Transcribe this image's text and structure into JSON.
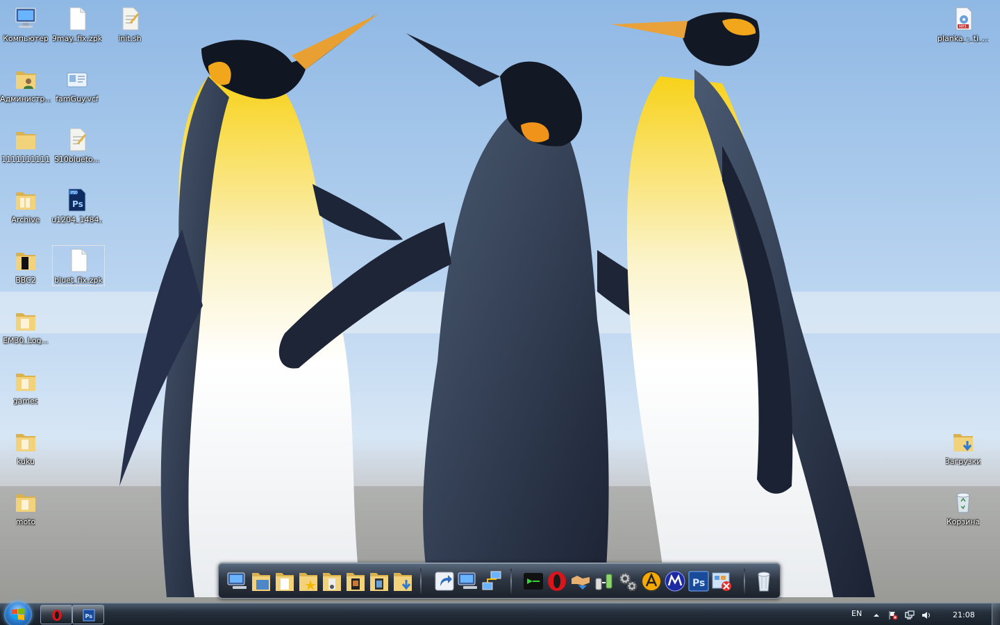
{
  "desktop": {
    "icons": [
      {
        "label": "Компьютер",
        "icon": "computer-icon"
      },
      {
        "label": "9may_fix.zpk",
        "icon": "file-icon"
      },
      {
        "label": "init.sh",
        "icon": "script-file-icon"
      },
      {
        "label": "Администр...",
        "icon": "user-folder-icon"
      },
      {
        "label": "famGuy.vcf",
        "icon": "contact-card-icon"
      },
      {
        "label": "1111111111",
        "icon": "folder-icon"
      },
      {
        "label": "S10blueto...",
        "icon": "script-file-icon"
      },
      {
        "label": "Archive",
        "icon": "folder-icon"
      },
      {
        "label": "u1204_1484...",
        "icon": "photoshop-file-icon"
      },
      {
        "label": "BBC2",
        "icon": "folder-icon"
      },
      {
        "label": "bluet_fix.zpk",
        "icon": "file-icon"
      },
      {
        "label": "EM30_Log...",
        "icon": "folder-icon"
      },
      {
        "label": "games",
        "icon": "folder-icon"
      },
      {
        "label": "kuku",
        "icon": "folder-icon"
      },
      {
        "label": "moto",
        "icon": "folder-icon"
      },
      {
        "label": "planka_-_ti_...",
        "icon": "mp3-file-icon"
      },
      {
        "label": "Загрузки",
        "icon": "downloads-folder-icon"
      },
      {
        "label": "Корзина",
        "icon": "recycle-bin-icon"
      }
    ]
  },
  "dock": {
    "items": [
      "computer-icon",
      "documents-folder-icon",
      "document-folder-icon",
      "favorites-folder-icon",
      "music-folder-icon",
      "pictures-folder-icon",
      "videos-folder-icon",
      "downloads-folder-icon",
      "shortcut-icon",
      "network-computer-icon",
      "network-connections-icon",
      "terminal-icon",
      "opera-icon",
      "handshake-icon",
      "bluetooth-transfer-icon",
      "settings-gears-icon",
      "aimp-icon",
      "motorola-icon",
      "photoshop-icon",
      "uninstall-icon",
      "recycle-bin-icon"
    ]
  },
  "taskbar": {
    "buttons": [
      "opera-icon",
      "photoshop-icon"
    ],
    "language": "EN",
    "clock": "21:08"
  },
  "colors": {
    "folder": "#f2d27a",
    "taskbar": "#1e2833",
    "accent": "#2c7fd4"
  }
}
